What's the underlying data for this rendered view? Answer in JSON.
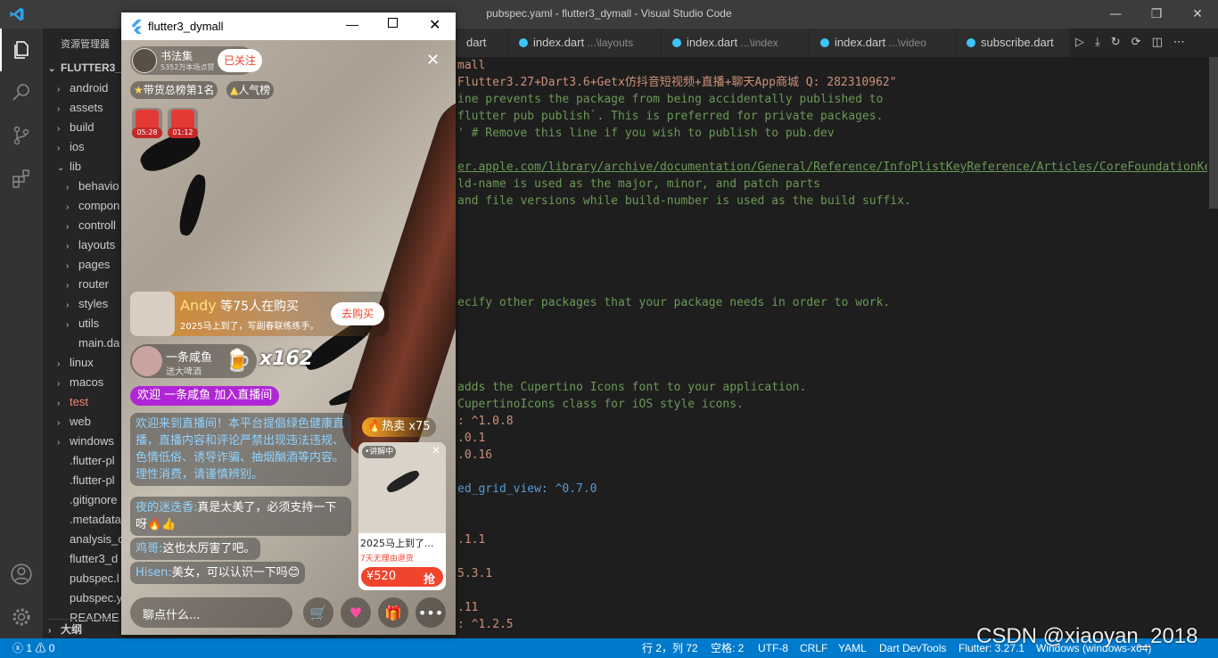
{
  "window": {
    "title": "pubspec.yaml - flutter3_dymall - Visual Studio Code"
  },
  "sidebar": {
    "header": "资源管理器",
    "project": "FLUTTER3_DY",
    "items": [
      {
        "label": "android",
        "chev": "›"
      },
      {
        "label": "assets",
        "chev": "›"
      },
      {
        "label": "build",
        "chev": "›"
      },
      {
        "label": "ios",
        "chev": "›"
      },
      {
        "label": "lib",
        "chev": "⌄"
      },
      {
        "label": "behavio",
        "chev": "›"
      },
      {
        "label": "compon",
        "chev": "›"
      },
      {
        "label": "controll",
        "chev": "›"
      },
      {
        "label": "layouts",
        "chev": "›"
      },
      {
        "label": "pages",
        "chev": "›"
      },
      {
        "label": "router",
        "chev": "›"
      },
      {
        "label": "styles",
        "chev": "›"
      },
      {
        "label": "utils",
        "chev": "›"
      },
      {
        "label": "main.da",
        "chev": ""
      },
      {
        "label": "linux",
        "chev": "›"
      },
      {
        "label": "macos",
        "chev": "›"
      },
      {
        "label": "test",
        "chev": "›"
      },
      {
        "label": "web",
        "chev": "›"
      },
      {
        "label": "windows",
        "chev": "›"
      },
      {
        "label": ".flutter-pl",
        "chev": ""
      },
      {
        "label": ".flutter-pl",
        "chev": ""
      },
      {
        "label": ".gitignore",
        "chev": ""
      },
      {
        "label": ".metadata",
        "chev": ""
      },
      {
        "label": "analysis_o",
        "chev": ""
      },
      {
        "label": "flutter3_d",
        "chev": ""
      },
      {
        "label": "pubspec.l",
        "chev": ""
      },
      {
        "label": "pubspec.y",
        "chev": ""
      },
      {
        "label": "README",
        "chev": ""
      }
    ],
    "outline": "大纲"
  },
  "tabs": [
    {
      "label": "dart",
      "desc": ""
    },
    {
      "label": "index.dart",
      "desc": "...\\layouts"
    },
    {
      "label": "index.dart",
      "desc": "...\\index"
    },
    {
      "label": "index.dart",
      "desc": "...\\video"
    },
    {
      "label": "subscribe.dart",
      "desc": ""
    }
  ],
  "code": [
    {
      "cls": "c-string",
      "text": "mall"
    },
    {
      "cls": "c-string",
      "text": "Flutter3.27+Dart3.6+Getx仿抖音短视频+直播+聊天App商城 Q: 282310962\""
    },
    {
      "cls": "c-comment",
      "text": "ine prevents the package from being accidentally published to"
    },
    {
      "cls": "c-comment",
      "text": "flutter pub publish`. This is preferred for private packages."
    },
    {
      "cls": "c-comment",
      "text": "' # Remove this line if you wish to publish to pub.dev"
    },
    {
      "cls": "c-plain",
      "text": ""
    },
    {
      "cls": "c-link",
      "text": "er.apple.com/library/archive/documentation/General/Reference/InfoPlistKeyReference/Articles/CoreFoundationKeys.h"
    },
    {
      "cls": "c-comment",
      "text": "ld-name is used as the major, minor, and patch parts"
    },
    {
      "cls": "c-comment",
      "text": "and file versions while build-number is used as the build suffix."
    },
    {
      "cls": "c-plain",
      "text": ""
    },
    {
      "cls": "c-plain",
      "text": ""
    },
    {
      "cls": "c-plain",
      "text": ""
    },
    {
      "cls": "c-plain",
      "text": ""
    },
    {
      "cls": "c-plain",
      "text": ""
    },
    {
      "cls": "c-comment",
      "text": "ecify other packages that your package needs in order to work."
    },
    {
      "cls": "c-plain",
      "text": ""
    },
    {
      "cls": "c-plain",
      "text": ""
    },
    {
      "cls": "c-plain",
      "text": ""
    },
    {
      "cls": "c-plain",
      "text": ""
    },
    {
      "cls": "c-comment",
      "text": "adds the Cupertino Icons font to your application."
    },
    {
      "cls": "c-comment",
      "text": "CupertinoIcons class for iOS style icons."
    },
    {
      "cls": "c-string",
      "text": ": ^1.0.8"
    },
    {
      "cls": "c-string",
      "text": ".0.1"
    },
    {
      "cls": "c-string",
      "text": ".0.16"
    },
    {
      "cls": "c-plain",
      "text": ""
    },
    {
      "cls": "c-key",
      "text": "ed_grid_view: ^0.7.0"
    },
    {
      "cls": "c-plain",
      "text": ""
    },
    {
      "cls": "c-plain",
      "text": ""
    },
    {
      "cls": "c-string",
      "text": ".1.1"
    },
    {
      "cls": "c-plain",
      "text": ""
    },
    {
      "cls": "c-string",
      "text": "5.3.1"
    },
    {
      "cls": "c-plain",
      "text": ""
    },
    {
      "cls": "c-string",
      "text": ".11"
    },
    {
      "cls": "c-string",
      "text": ": ^1.2.5"
    }
  ],
  "status": {
    "errors": "1",
    "warnings": "0",
    "position": "行 2，列 72",
    "spaces": "空格: 2",
    "encoding": "UTF-8",
    "eol": "CRLF",
    "language": "YAML",
    "devtools": "Dart DevTools",
    "flutter": "Flutter: 3.27.1",
    "platform": "Windows (windows-x64)"
  },
  "watermark": "CSDN @xiaoyan_2018",
  "app": {
    "title": "flutter3_dymall",
    "anchor": {
      "name": "书法集",
      "sub": "5352万本场点赞",
      "follow": "已关注"
    },
    "tags": [
      "带货总榜第1名",
      "人气榜"
    ],
    "redpacks": [
      "05:28",
      "01:12"
    ],
    "buying": {
      "user": "Andy",
      "text": "等75人在购买",
      "sub": "2025马上到了，写副春联练练手。",
      "btn": "去购买"
    },
    "gift": {
      "name": "一条咸鱼",
      "sub": "送大啤酒",
      "count": "x162"
    },
    "welcome": "欢迎 一条咸鱼 加入直播间",
    "system_msg": "欢迎来到直播间！本平台提倡绿色健康直播，直播内容和评论严禁出现违法违规、色情低俗、诱导诈骗、抽烟酗酒等内容。理性消费，请谨慎辨别。",
    "messages": [
      {
        "nick": "夜的迷迭香:",
        "text": "真是太美了，必须支持一下呀🔥👍"
      },
      {
        "nick": "鸡哥:",
        "text": "这也太厉害了吧。"
      },
      {
        "nick": "Hisen:",
        "text": "美女，可以认识一下吗😊"
      }
    ],
    "hot": "热卖 x75",
    "product": {
      "badge": "•讲解中",
      "title": "2025马上到了...",
      "tag": "7天无理由退货",
      "price": "¥520",
      "buy": "抢"
    },
    "input_placeholder": "聊点什么..."
  }
}
